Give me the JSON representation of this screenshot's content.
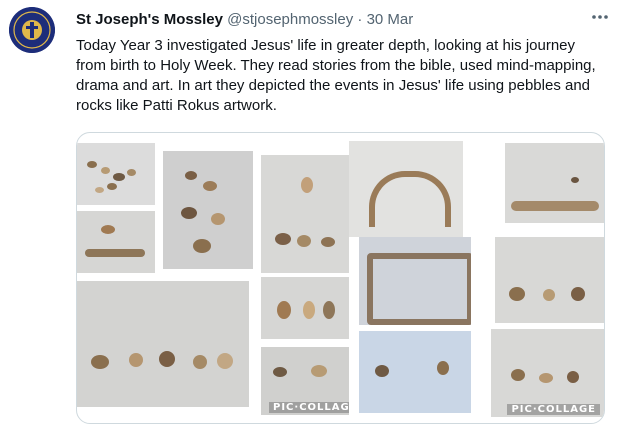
{
  "tweet": {
    "name": "St Joseph's Mossley",
    "handle": "@stjosephmossley",
    "separator": "·",
    "date": "30 Mar",
    "text": "Today Year 3 investigated Jesus' life in greater depth, looking at his journey from birth to Holy Week. They read stories from the bible, used mind-mapping, drama and art. In art they depicted the events in Jesus' life using pebbles and rocks like Patti Rokus artwork.",
    "more_icon": "more-horizontal-icon"
  },
  "collage": {
    "watermark_left": "PIC·COLLAGE",
    "watermark_right": "PIC·COLLAGE"
  },
  "colors": {
    "avatar_bg": "#1d2d7a",
    "accent": "#e0b84a",
    "border": "#cfd9de"
  }
}
